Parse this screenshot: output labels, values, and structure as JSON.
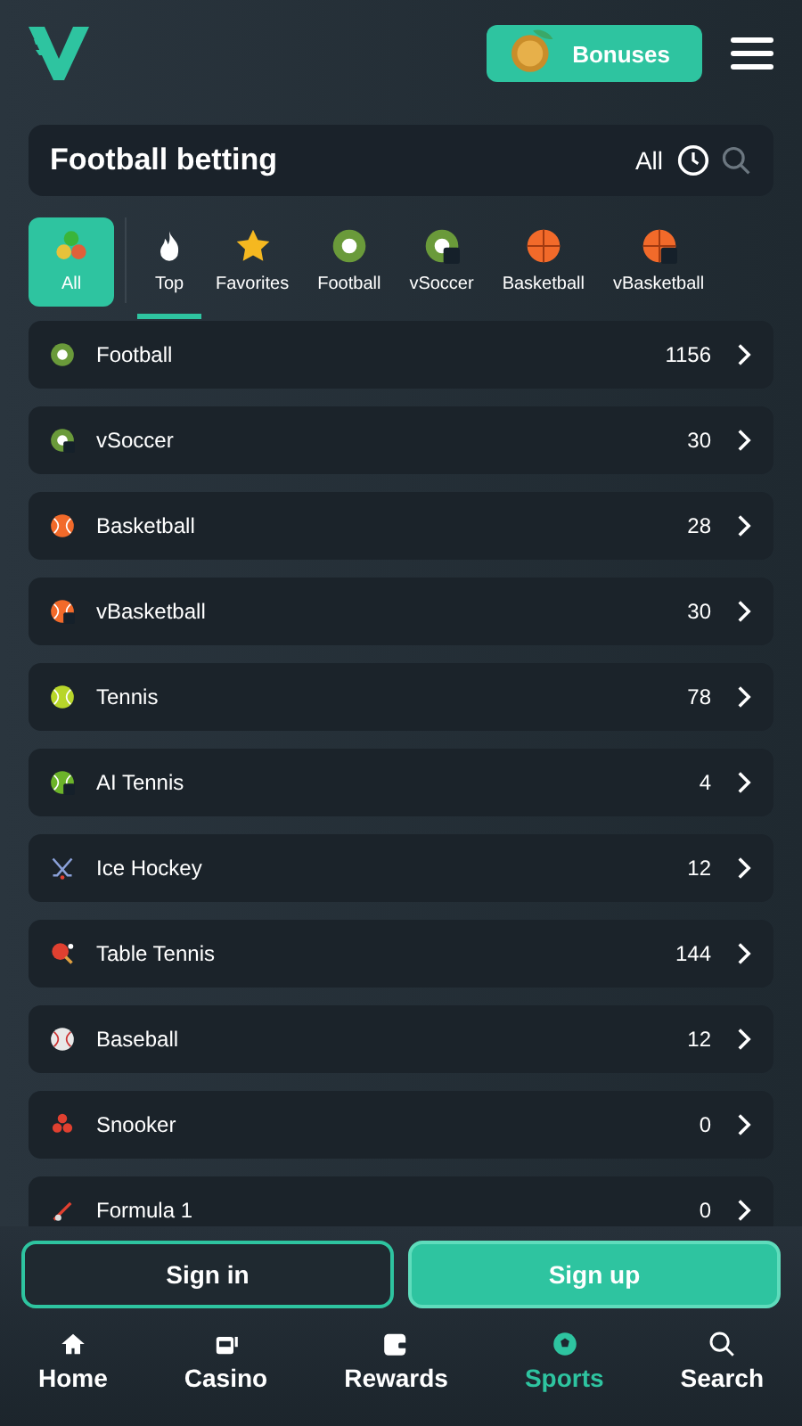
{
  "header": {
    "bonus_button": "Bonuses"
  },
  "search_bar": {
    "title": "Football betting",
    "filter": "All"
  },
  "categories": [
    {
      "label": "All",
      "kind": "all",
      "selected": true
    },
    {
      "label": "Top",
      "kind": "top",
      "selected": true
    },
    {
      "label": "Favorites",
      "kind": "favorites",
      "selected": false
    },
    {
      "label": "Football",
      "kind": "football",
      "selected": false
    },
    {
      "label": "vSoccer",
      "kind": "vsoccer",
      "selected": false
    },
    {
      "label": "Basketball",
      "kind": "basketball",
      "selected": false
    },
    {
      "label": "vBasketball",
      "kind": "vbasketball",
      "selected": false
    }
  ],
  "sports": [
    {
      "name": "Football",
      "count": "1156",
      "kind": "football"
    },
    {
      "name": "vSoccer",
      "count": "30",
      "kind": "vsoccer"
    },
    {
      "name": "Basketball",
      "count": "28",
      "kind": "basketball"
    },
    {
      "name": "vBasketball",
      "count": "30",
      "kind": "vbasketball"
    },
    {
      "name": "Tennis",
      "count": "78",
      "kind": "tennis"
    },
    {
      "name": "AI Tennis",
      "count": "4",
      "kind": "aitennis"
    },
    {
      "name": "Ice Hockey",
      "count": "12",
      "kind": "hockey"
    },
    {
      "name": "Table Tennis",
      "count": "144",
      "kind": "tabletennis"
    },
    {
      "name": "Baseball",
      "count": "12",
      "kind": "baseball"
    },
    {
      "name": "Snooker",
      "count": "0",
      "kind": "snooker"
    },
    {
      "name": "Formula 1",
      "count": "0",
      "kind": "formula"
    }
  ],
  "auth_buttons": {
    "sign_in": "Sign in",
    "sign_up": "Sign up"
  },
  "bottom_nav": [
    {
      "label": "Home",
      "kind": "home",
      "selected": false
    },
    {
      "label": "Casino",
      "kind": "casino",
      "selected": false
    },
    {
      "label": "Rewards",
      "kind": "rewards",
      "selected": false
    },
    {
      "label": "Sports",
      "kind": "sports",
      "selected": true
    },
    {
      "label": "Search",
      "kind": "search",
      "selected": false
    }
  ]
}
